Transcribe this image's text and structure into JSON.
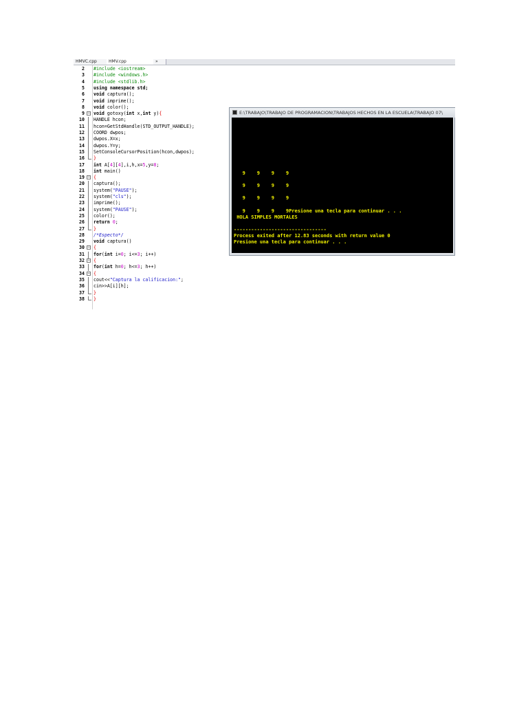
{
  "editor": {
    "tabs": [
      "HMVC.cpp",
      "HMV.cpp",
      "»"
    ],
    "lines": [
      {
        "n": "2",
        "seg": [
          {
            "t": "#include <iostream>",
            "c": "pp"
          }
        ]
      },
      {
        "n": "3",
        "seg": [
          {
            "t": "#include <windows.h>",
            "c": "pp"
          }
        ]
      },
      {
        "n": "4",
        "seg": [
          {
            "t": "#include <stdlib.h>",
            "c": "pp"
          }
        ]
      },
      {
        "n": "5",
        "seg": [
          {
            "t": "using namespace std;",
            "c": "kw"
          }
        ]
      },
      {
        "n": "6",
        "seg": [
          {
            "t": "void",
            "c": "kw"
          },
          {
            "t": " captura();"
          }
        ]
      },
      {
        "n": "7",
        "seg": [
          {
            "t": "void",
            "c": "kw"
          },
          {
            "t": " imprime();"
          }
        ]
      },
      {
        "n": "8",
        "seg": [
          {
            "t": "void",
            "c": "kw"
          },
          {
            "t": " color();"
          }
        ]
      },
      {
        "n": "9",
        "fold": "box",
        "seg": [
          {
            "t": "void",
            "c": "kw"
          },
          {
            "t": " gotoxy("
          },
          {
            "t": "int",
            "c": "kw"
          },
          {
            "t": " x,"
          },
          {
            "t": "int",
            "c": "kw"
          },
          {
            "t": " y)"
          },
          {
            "t": "{",
            "c": "brace"
          }
        ]
      },
      {
        "n": "10",
        "fold": "bar",
        "seg": [
          {
            "t": "HANDLE hcon;"
          }
        ]
      },
      {
        "n": "11",
        "fold": "bar",
        "seg": [
          {
            "t": "hcon=GetStdHandle(STD_OUTPUT_HANDLE);"
          }
        ]
      },
      {
        "n": "12",
        "fold": "bar",
        "seg": [
          {
            "t": "COORD dwpos;"
          }
        ]
      },
      {
        "n": "13",
        "fold": "bar",
        "seg": [
          {
            "t": "dwpos.X=x;"
          }
        ]
      },
      {
        "n": "14",
        "fold": "bar",
        "seg": [
          {
            "t": "dwpos.Y=y;"
          }
        ]
      },
      {
        "n": "15",
        "fold": "bar",
        "seg": [
          {
            "t": "SetConsoleCursorPosition(hcon,dwpos);"
          }
        ]
      },
      {
        "n": "16",
        "fold": "end",
        "seg": [
          {
            "t": "}",
            "c": "brace"
          }
        ]
      },
      {
        "n": "17",
        "seg": [
          {
            "t": "int",
            "c": "kw"
          },
          {
            "t": " A["
          },
          {
            "t": "4",
            "c": "num"
          },
          {
            "t": "]["
          },
          {
            "t": "4",
            "c": "num"
          },
          {
            "t": "],i,h,x="
          },
          {
            "t": "5",
            "c": "num"
          },
          {
            "t": ",y="
          },
          {
            "t": "8",
            "c": "num"
          },
          {
            "t": ";"
          }
        ]
      },
      {
        "n": "18",
        "seg": [
          {
            "t": "int",
            "c": "kw"
          },
          {
            "t": " main()"
          }
        ]
      },
      {
        "n": "19",
        "fold": "box",
        "seg": [
          {
            "t": "{",
            "c": "brace"
          }
        ]
      },
      {
        "n": "20",
        "fold": "bar",
        "seg": [
          {
            "t": "captura();"
          }
        ]
      },
      {
        "n": "21",
        "fold": "bar",
        "seg": [
          {
            "t": "system("
          },
          {
            "t": "\"PAUSE\"",
            "c": "str"
          },
          {
            "t": ");"
          }
        ]
      },
      {
        "n": "22",
        "fold": "bar",
        "seg": [
          {
            "t": "system("
          },
          {
            "t": "\"cls\"",
            "c": "str"
          },
          {
            "t": ");"
          }
        ]
      },
      {
        "n": "23",
        "fold": "bar",
        "seg": [
          {
            "t": "imprime();"
          }
        ]
      },
      {
        "n": "24",
        "fold": "bar",
        "seg": [
          {
            "t": "system("
          },
          {
            "t": "\"PAUSE\"",
            "c": "str"
          },
          {
            "t": ");"
          }
        ]
      },
      {
        "n": "25",
        "fold": "bar",
        "seg": [
          {
            "t": "color();"
          }
        ]
      },
      {
        "n": "26",
        "fold": "bar",
        "seg": [
          {
            "t": "return",
            "c": "kw"
          },
          {
            "t": " "
          },
          {
            "t": "0",
            "c": "num"
          },
          {
            "t": ";"
          }
        ]
      },
      {
        "n": "27",
        "fold": "end",
        "seg": [
          {
            "t": "}",
            "c": "brace"
          }
        ]
      },
      {
        "n": "28",
        "seg": [
          {
            "t": "/*Especto*/",
            "c": "cm"
          }
        ]
      },
      {
        "n": "29",
        "seg": [
          {
            "t": "void",
            "c": "kw"
          },
          {
            "t": " captura()"
          }
        ]
      },
      {
        "n": "30",
        "fold": "box",
        "seg": [
          {
            "t": "{",
            "c": "brace"
          }
        ]
      },
      {
        "n": "31",
        "fold": "bar",
        "seg": [
          {
            "t": "for",
            "c": "kw"
          },
          {
            "t": "("
          },
          {
            "t": "int",
            "c": "kw"
          },
          {
            "t": " i="
          },
          {
            "t": "0",
            "c": "num"
          },
          {
            "t": "; i<="
          },
          {
            "t": "3",
            "c": "num"
          },
          {
            "t": "; i++)"
          }
        ]
      },
      {
        "n": "32",
        "fold": "box",
        "seg": [
          {
            "t": "{",
            "c": "brace"
          }
        ]
      },
      {
        "n": "33",
        "fold": "bar",
        "seg": [
          {
            "t": "for",
            "c": "kw"
          },
          {
            "t": "("
          },
          {
            "t": "int",
            "c": "kw"
          },
          {
            "t": " h="
          },
          {
            "t": "0",
            "c": "num"
          },
          {
            "t": "; h<="
          },
          {
            "t": "3",
            "c": "num"
          },
          {
            "t": "; h++)"
          }
        ]
      },
      {
        "n": "34",
        "fold": "box",
        "seg": [
          {
            "t": "{",
            "c": "brace"
          }
        ]
      },
      {
        "n": "35",
        "fold": "bar",
        "seg": [
          {
            "t": "cout<<"
          },
          {
            "t": "\"Captura la calificacion:\"",
            "c": "str"
          },
          {
            "t": ";"
          }
        ]
      },
      {
        "n": "36",
        "fold": "bar",
        "seg": [
          {
            "t": "cin>>A[i][h];"
          }
        ]
      },
      {
        "n": "37",
        "fold": "end",
        "seg": [
          {
            "t": "}",
            "c": "brace"
          }
        ]
      },
      {
        "n": "38",
        "fold": "end",
        "seg": [
          {
            "t": "}",
            "c": "brace"
          }
        ]
      }
    ]
  },
  "console": {
    "title": "E:\\TRABAJO\\TRABAJO DE PROGRAMACION\\TRABAJOS HECHOS EN LA ESCUELA\\TRABAJO 07\\",
    "lines": [
      {
        "row": 9,
        "text": "   9    9    9    9"
      },
      {
        "row": 11,
        "text": "   9    9    9    9"
      },
      {
        "row": 13,
        "text": "   9    9    9    9"
      },
      {
        "row": 15,
        "text": "   9    9    9    9Presione una tecla para continuar . . ."
      },
      {
        "row": 16,
        "text": " HOLA SIMPLES MORTALES"
      },
      {
        "row": 18,
        "text": "--------------------------------"
      },
      {
        "row": 19,
        "text": "Process exited after 12.83 seconds with return value 0"
      },
      {
        "row": 20,
        "text": "Presione una tecla para continuar . . ."
      }
    ]
  }
}
